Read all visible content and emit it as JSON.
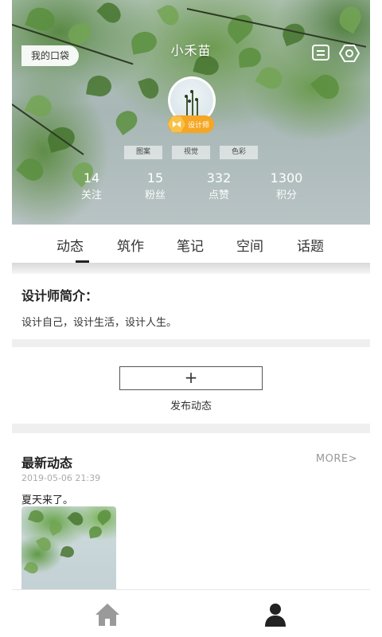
{
  "header": {
    "pocket_label": "我的口袋",
    "username": "小禾苗",
    "badge_label": "设计师",
    "tags": [
      "图案",
      "视觉",
      "色彩"
    ],
    "stats": [
      {
        "value": "14",
        "label": "关注"
      },
      {
        "value": "15",
        "label": "粉丝"
      },
      {
        "value": "332",
        "label": "点赞"
      },
      {
        "value": "1300",
        "label": "积分"
      }
    ],
    "message_icon": "message-icon",
    "settings_icon": "settings-icon"
  },
  "tabs": [
    "动态",
    "筑作",
    "笔记",
    "空间",
    "话题"
  ],
  "active_tab": "动态",
  "intro": {
    "title": "设计师简介：",
    "text": "设计自己，设计生活，设计人生。"
  },
  "post": {
    "plus": "+",
    "label": "发布动态"
  },
  "latest": {
    "title": "最新动态",
    "more": "MORE>",
    "date": "2019-05-06 21:39",
    "text": "夏天来了。"
  },
  "bottom_nav": {
    "items": [
      {
        "icon": "home-icon",
        "active": false
      },
      {
        "icon": "user-icon",
        "active": true
      }
    ]
  },
  "colors": {
    "accent_badge": "#f5a623",
    "header_green": "#5b8f3e",
    "text_dark": "#222222",
    "muted": "#999999"
  }
}
